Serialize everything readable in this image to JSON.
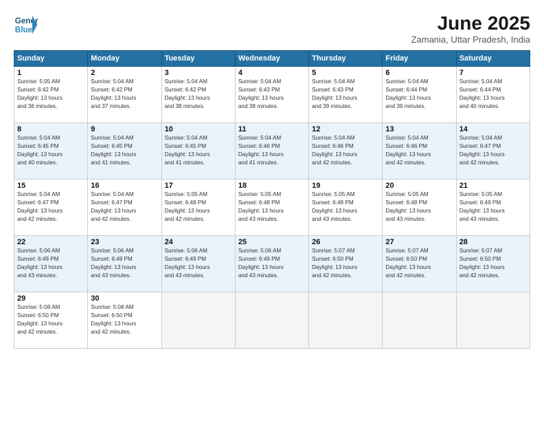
{
  "header": {
    "logo_line1": "General",
    "logo_line2": "Blue",
    "month": "June 2025",
    "location": "Zamania, Uttar Pradesh, India"
  },
  "weekdays": [
    "Sunday",
    "Monday",
    "Tuesday",
    "Wednesday",
    "Thursday",
    "Friday",
    "Saturday"
  ],
  "weeks": [
    [
      {
        "day": 1,
        "rise": "5:05 AM",
        "set": "6:42 PM",
        "hours": "13 hours",
        "min": "36 minutes"
      },
      {
        "day": 2,
        "rise": "5:04 AM",
        "set": "6:42 PM",
        "hours": "13 hours",
        "min": "37 minutes"
      },
      {
        "day": 3,
        "rise": "5:04 AM",
        "set": "6:42 PM",
        "hours": "13 hours",
        "min": "38 minutes"
      },
      {
        "day": 4,
        "rise": "5:04 AM",
        "set": "6:43 PM",
        "hours": "13 hours",
        "min": "38 minutes"
      },
      {
        "day": 5,
        "rise": "5:04 AM",
        "set": "6:43 PM",
        "hours": "13 hours",
        "min": "39 minutes"
      },
      {
        "day": 6,
        "rise": "5:04 AM",
        "set": "6:44 PM",
        "hours": "13 hours",
        "min": "39 minutes"
      },
      {
        "day": 7,
        "rise": "5:04 AM",
        "set": "6:44 PM",
        "hours": "13 hours",
        "min": "40 minutes"
      }
    ],
    [
      {
        "day": 8,
        "rise": "5:04 AM",
        "set": "6:45 PM",
        "hours": "13 hours",
        "min": "40 minutes"
      },
      {
        "day": 9,
        "rise": "5:04 AM",
        "set": "6:45 PM",
        "hours": "13 hours",
        "min": "41 minutes"
      },
      {
        "day": 10,
        "rise": "5:04 AM",
        "set": "6:45 PM",
        "hours": "13 hours",
        "min": "41 minutes"
      },
      {
        "day": 11,
        "rise": "5:04 AM",
        "set": "6:46 PM",
        "hours": "13 hours",
        "min": "41 minutes"
      },
      {
        "day": 12,
        "rise": "5:04 AM",
        "set": "6:46 PM",
        "hours": "13 hours",
        "min": "42 minutes"
      },
      {
        "day": 13,
        "rise": "5:04 AM",
        "set": "6:46 PM",
        "hours": "13 hours",
        "min": "42 minutes"
      },
      {
        "day": 14,
        "rise": "5:04 AM",
        "set": "6:47 PM",
        "hours": "13 hours",
        "min": "42 minutes"
      }
    ],
    [
      {
        "day": 15,
        "rise": "5:04 AM",
        "set": "6:47 PM",
        "hours": "13 hours",
        "min": "42 minutes"
      },
      {
        "day": 16,
        "rise": "5:04 AM",
        "set": "6:47 PM",
        "hours": "13 hours",
        "min": "42 minutes"
      },
      {
        "day": 17,
        "rise": "5:05 AM",
        "set": "6:48 PM",
        "hours": "13 hours",
        "min": "42 minutes"
      },
      {
        "day": 18,
        "rise": "5:05 AM",
        "set": "6:48 PM",
        "hours": "13 hours",
        "min": "43 minutes"
      },
      {
        "day": 19,
        "rise": "5:05 AM",
        "set": "6:48 PM",
        "hours": "13 hours",
        "min": "43 minutes"
      },
      {
        "day": 20,
        "rise": "5:05 AM",
        "set": "6:48 PM",
        "hours": "13 hours",
        "min": "43 minutes"
      },
      {
        "day": 21,
        "rise": "5:05 AM",
        "set": "6:49 PM",
        "hours": "13 hours",
        "min": "43 minutes"
      }
    ],
    [
      {
        "day": 22,
        "rise": "5:06 AM",
        "set": "6:49 PM",
        "hours": "13 hours",
        "min": "43 minutes"
      },
      {
        "day": 23,
        "rise": "5:06 AM",
        "set": "6:49 PM",
        "hours": "13 hours",
        "min": "43 minutes"
      },
      {
        "day": 24,
        "rise": "5:06 AM",
        "set": "6:49 PM",
        "hours": "13 hours",
        "min": "43 minutes"
      },
      {
        "day": 25,
        "rise": "5:06 AM",
        "set": "6:49 PM",
        "hours": "13 hours",
        "min": "43 minutes"
      },
      {
        "day": 26,
        "rise": "5:07 AM",
        "set": "6:50 PM",
        "hours": "13 hours",
        "min": "42 minutes"
      },
      {
        "day": 27,
        "rise": "5:07 AM",
        "set": "6:50 PM",
        "hours": "13 hours",
        "min": "42 minutes"
      },
      {
        "day": 28,
        "rise": "5:07 AM",
        "set": "6:50 PM",
        "hours": "13 hours",
        "min": "42 minutes"
      }
    ],
    [
      {
        "day": 29,
        "rise": "5:08 AM",
        "set": "6:50 PM",
        "hours": "13 hours",
        "min": "42 minutes"
      },
      {
        "day": 30,
        "rise": "5:08 AM",
        "set": "6:50 PM",
        "hours": "13 hours",
        "min": "42 minutes"
      },
      null,
      null,
      null,
      null,
      null
    ]
  ]
}
